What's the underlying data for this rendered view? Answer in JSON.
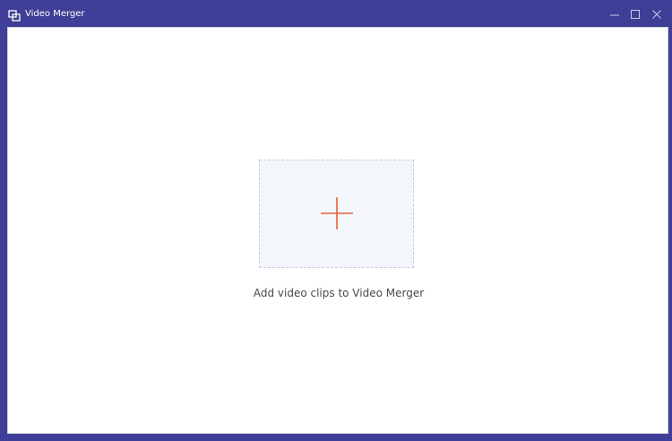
{
  "window": {
    "title": "Video Merger",
    "icon": "merge-icon",
    "controls": [
      "minimize-icon",
      "maximize-icon",
      "close-icon"
    ]
  },
  "main": {
    "add_icon": "plus-icon",
    "drop_label": "Add video clips to Video Merger"
  },
  "colors": {
    "titlebar": "#3f3f97",
    "accent_plus": "#e8603c",
    "drop_zone_bg": "#f3f6fb",
    "drop_zone_border": "#c7ccd9"
  }
}
